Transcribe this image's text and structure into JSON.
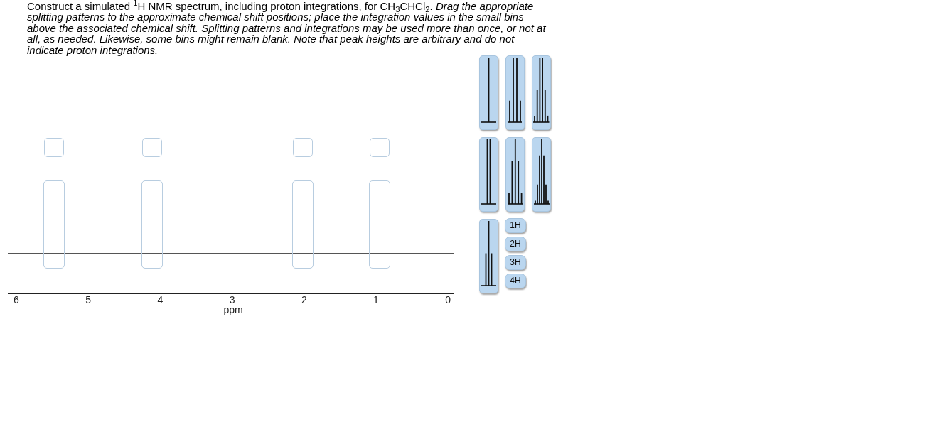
{
  "question": {
    "text": "Construct a simulated $^{1}$H NMR spectrum, including proton integrations, for CH$_{3}$CHCl$_{2}$. *Drag the appropriate splitting patterns to the approximate chemical shift positions; place the integration values in the small bins above the associated chemical shift. Splitting patterns and integrations may be used more than once, or not at all, as needed. Likewise, some bins might remain blank. Note that peak heights are arbitrary and do not indicate proton integrations.*"
  },
  "spectrum": {
    "drop_bins": [
      {
        "integration_filled": false,
        "pattern_filled": false
      },
      {
        "integration_filled": false,
        "pattern_filled": false
      },
      {
        "integration_filled": false,
        "pattern_filled": false
      },
      {
        "integration_filled": false,
        "pattern_filled": false
      }
    ],
    "axis": {
      "ticks": [
        "6",
        "5",
        "4",
        "3",
        "2",
        "1",
        "0"
      ],
      "label": "ppm"
    }
  },
  "palette": {
    "splitting_patterns": [
      {
        "kind": "singlet"
      },
      {
        "kind": "quartet"
      },
      {
        "kind": "sextet"
      },
      {
        "kind": "doublet"
      },
      {
        "kind": "quintet"
      },
      {
        "kind": "septet"
      },
      {
        "kind": "triplet"
      }
    ],
    "integrations": [
      "1H",
      "2H",
      "3H",
      "4H"
    ]
  }
}
